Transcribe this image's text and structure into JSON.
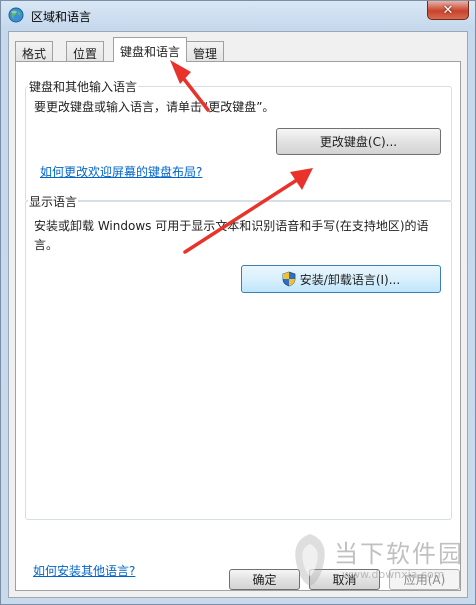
{
  "window": {
    "title": "区域和语言",
    "close_glyph": "✕"
  },
  "tabs": [
    {
      "label": "格式",
      "active": false
    },
    {
      "label": "位置",
      "active": false
    },
    {
      "label": "键盘和语言",
      "active": true
    },
    {
      "label": "管理",
      "active": false
    }
  ],
  "keyboard_group": {
    "title": "键盘和其他输入语言",
    "description": "要更改键盘或输入语言，请单击“更改键盘”。",
    "change_button": "更改键盘(C)...",
    "welcome_link": "如何更改欢迎屏幕的键盘布局?"
  },
  "display_group": {
    "title": "显示语言",
    "description_line1": "安装或卸载 Windows 可用于显示文本和识别语音和手写(在支持地区)的语",
    "description_line2": "言。",
    "install_button": "安装/卸载语言(I)..."
  },
  "footer": {
    "install_link": "如何安装其他语言?",
    "ok_button": "确定",
    "cancel_button": "取消",
    "apply_button": "应用(A)"
  },
  "watermark": {
    "text": "当下软件园",
    "url": "www.downxia.com"
  },
  "colors": {
    "annotation_arrow": "#e8322a",
    "link": "#0066cc"
  }
}
